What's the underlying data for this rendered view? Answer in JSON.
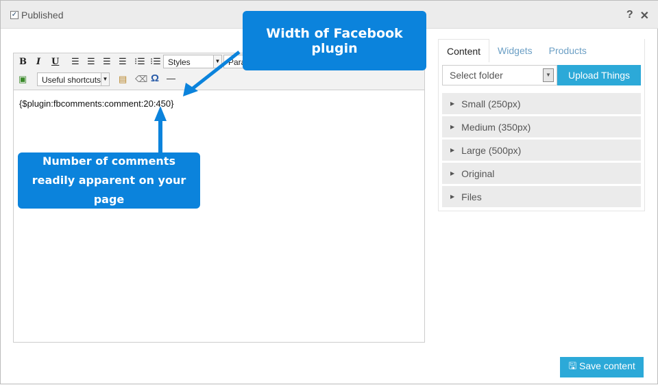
{
  "header": {
    "published_label": "Published",
    "published_checked": true,
    "help": "?",
    "close": "✕"
  },
  "toolbar": {
    "bold": "B",
    "italic": "I",
    "underline": "U",
    "styles": "Styles",
    "format": "Paragraph",
    "shortcuts": "Useful shortcuts",
    "omega": "Ω",
    "hr": "—"
  },
  "editor": {
    "content": "{$plugin:fbcomments:comment:20:450}"
  },
  "callouts": {
    "width": "Width of Facebook plugin",
    "comments": "Number of comments readily apparent on your page"
  },
  "sidebar": {
    "tabs": [
      {
        "label": "Content"
      },
      {
        "label": "Widgets"
      },
      {
        "label": "Products"
      }
    ],
    "folder_placeholder": "Select folder",
    "upload": "Upload Things",
    "items": [
      {
        "label": "Small (250px)"
      },
      {
        "label": "Medium (350px)"
      },
      {
        "label": "Large (500px)"
      },
      {
        "label": "Original"
      },
      {
        "label": "Files"
      }
    ]
  },
  "footer": {
    "save": "Save content"
  },
  "colors": {
    "accent": "#2ca9d8",
    "callout": "#0b83dc"
  }
}
